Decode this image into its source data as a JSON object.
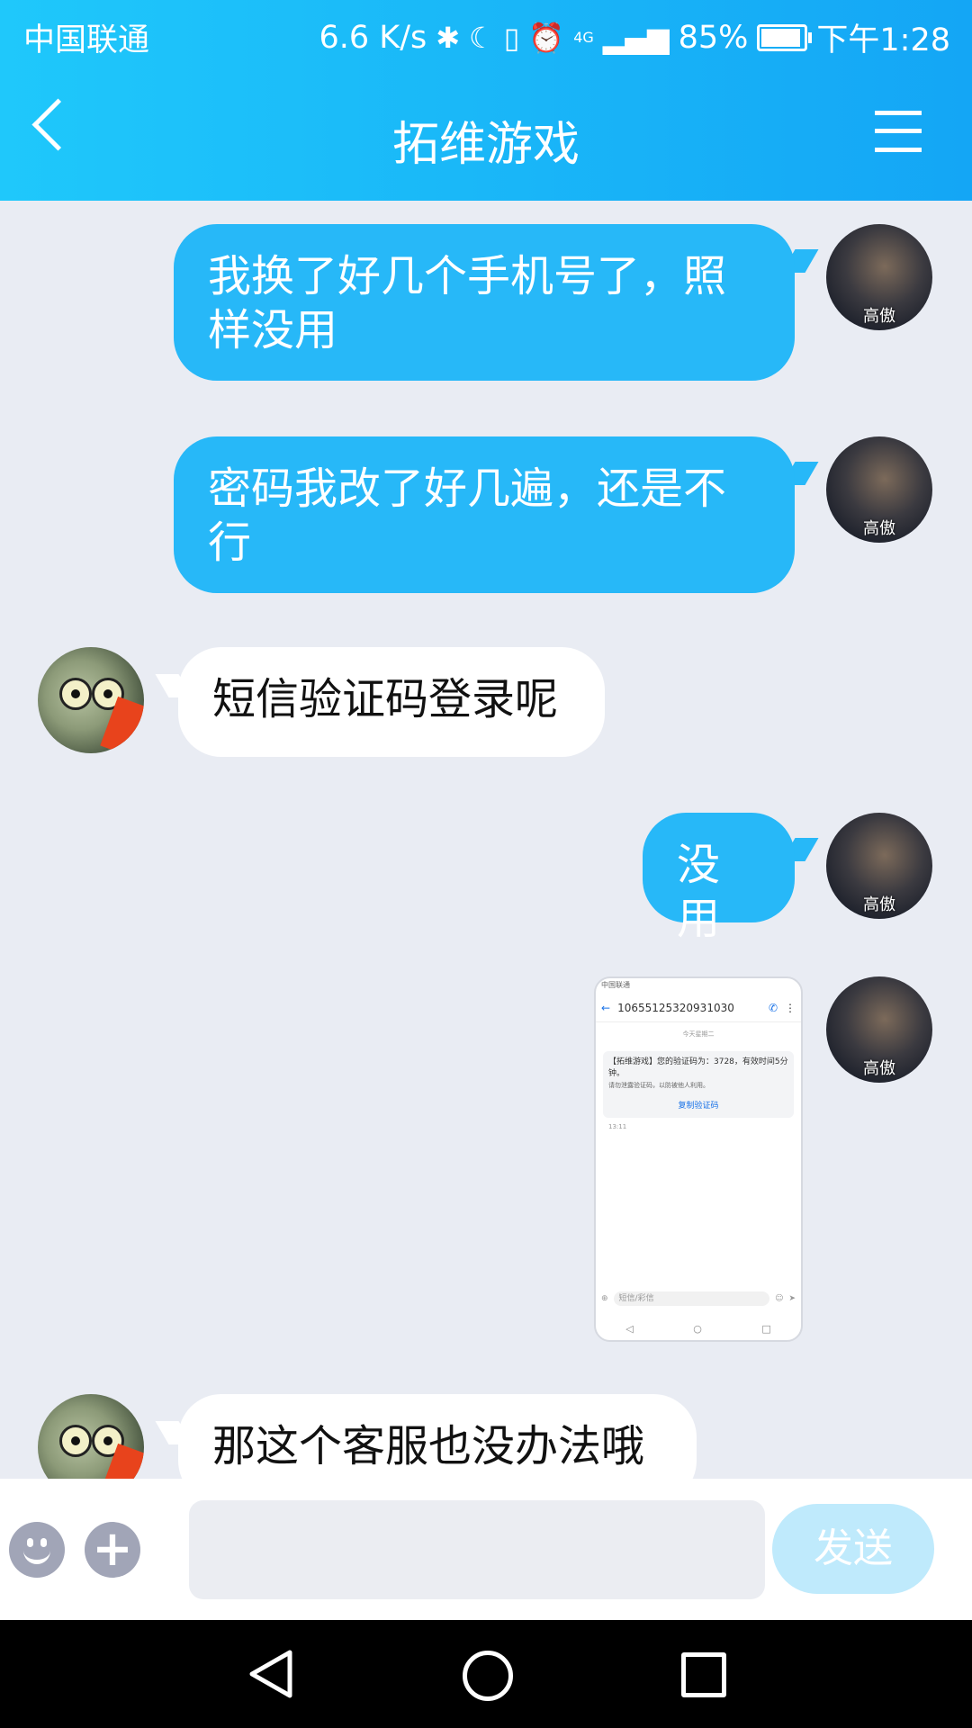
{
  "status_bar": {
    "carrier": "中国联通",
    "speed": "6.6 K/s",
    "network": "4G",
    "battery": "85%",
    "time": "下午1:28"
  },
  "header": {
    "title": "拓维游戏"
  },
  "messages": [
    {
      "side": "right",
      "avatar_label": "高傲",
      "text": "我换了好几个手机号了，照样没用"
    },
    {
      "side": "right",
      "avatar_label": "高傲",
      "text": "密码我改了好几遍，还是不行"
    },
    {
      "side": "left",
      "text": "短信验证码登录呢"
    },
    {
      "side": "right",
      "avatar_label": "高傲",
      "text": "没用"
    },
    {
      "side": "right",
      "avatar_label": "高傲",
      "type": "image"
    },
    {
      "side": "left",
      "text": "那这个客服也没办法哦"
    }
  ],
  "screenshot_image": {
    "status": "中国联通",
    "phone_number": "10655125320931030",
    "sub_header": "今天星期二",
    "sms_text": "【拓维游戏】您的验证码为：3728，有效时间5分钟。",
    "notice": "请勿泄露验证码，以防被他人利用。",
    "copy_label": "复制验证码",
    "time": "13:11",
    "input_placeholder": "短信/彩信"
  },
  "input_bar": {
    "placeholder": "",
    "send_label": "发送"
  },
  "colors": {
    "header_start": "#1fc8fb",
    "header_end": "#14a6f5",
    "my_bubble": "#27b8f8",
    "chat_bg": "#e9ecf3",
    "send_button": "#bfeafc"
  }
}
